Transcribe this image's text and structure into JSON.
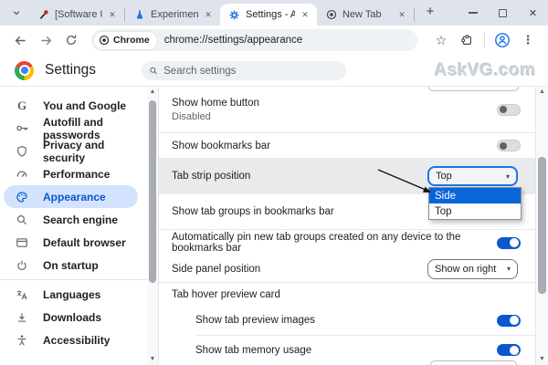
{
  "colors": {
    "accent": "#0b57d0",
    "toggle_on": "#0b57d0",
    "selected_nav_bg": "#d3e3fd",
    "menu_selection_bg": "#0a66d8",
    "tabstrip_bg": "#dfe3ec",
    "row_highlight": "#e9eaeb"
  },
  "icons": {
    "tab-search": "chevron-down",
    "tab-close": "x",
    "new-tab": "plus",
    "minimize": "dash",
    "maximize": "square",
    "close-window": "x",
    "back": "arrow-left",
    "forward": "arrow-right",
    "reload": "circular-arrow",
    "site-badge": "chrome-logo-mono",
    "bookmark": "star-outline",
    "extensions": "puzzle-piece",
    "profile": "person-in-circle",
    "menu": "kebab-dots",
    "settings-search": "magnifier",
    "scroll-up": "triangle-up",
    "scroll-down": "triangle-down",
    "annotation": "black-arrow"
  },
  "tabstrip": {
    "close_glyph": "✕",
    "new_tab_glyph": "+",
    "tabs": [
      {
        "title": "[Software Updat",
        "favicon": "software-update-icon",
        "active": false
      },
      {
        "title": "Experiments",
        "favicon": "flask-icon",
        "active": false
      },
      {
        "title": "Settings - Appea",
        "favicon": "settings-gear-icon",
        "active": true
      },
      {
        "title": "New Tab",
        "favicon": "chrome-mono-icon",
        "active": false
      }
    ]
  },
  "toolbar": {
    "chip_label": "Chrome",
    "url": "chrome://settings/appearance",
    "star_glyph": "☆",
    "kebab_glyph": "⋮"
  },
  "header": {
    "title": "Settings",
    "search_placeholder": "Search settings",
    "watermark": "AskVG.com"
  },
  "sidebar": {
    "items": [
      {
        "label": "You and Google",
        "icon": "google-g-icon",
        "selected": false
      },
      {
        "label": "Autofill and passwords",
        "icon": "key-icon",
        "selected": false
      },
      {
        "label": "Privacy and security",
        "icon": "shield-icon",
        "selected": false
      },
      {
        "label": "Performance",
        "icon": "speedometer-icon",
        "selected": false
      },
      {
        "label": "Appearance",
        "icon": "palette-icon",
        "selected": true
      },
      {
        "label": "Search engine",
        "icon": "search-icon",
        "selected": false
      },
      {
        "label": "Default browser",
        "icon": "browser-window-icon",
        "selected": false
      },
      {
        "label": "On startup",
        "icon": "power-icon",
        "selected": false
      },
      {
        "label": "Languages",
        "icon": "translate-icon",
        "selected": false
      },
      {
        "label": "Downloads",
        "icon": "download-icon",
        "selected": false
      },
      {
        "label": "Accessibility",
        "icon": "accessibility-icon",
        "selected": false
      }
    ]
  },
  "content": {
    "rows": {
      "show_home_button": {
        "label": "Show home button",
        "sublabel": "Disabled",
        "toggle": "off"
      },
      "show_bookmarks_bar": {
        "label": "Show bookmarks bar",
        "toggle": "off"
      },
      "tab_strip_position": {
        "label": "Tab strip position",
        "value": "Top"
      },
      "show_tab_groups": {
        "label": "Show tab groups in bookmarks bar"
      },
      "auto_pin": {
        "label": "Automatically pin new tab groups created on any device to the bookmarks bar",
        "toggle": "on"
      },
      "side_panel_position": {
        "label": "Side panel position",
        "value": "Show on right"
      },
      "tab_hover_preview": {
        "label": "Tab hover preview card"
      },
      "show_tab_preview_images": {
        "label": "Show tab preview images",
        "toggle": "on"
      },
      "show_tab_memory_usage": {
        "label": "Show tab memory usage",
        "toggle": "on"
      }
    },
    "dropdown_menu": {
      "options": [
        {
          "label": "Side",
          "highlighted": true
        },
        {
          "label": "Top",
          "highlighted": false
        }
      ]
    },
    "select_caret_glyph": "▾"
  },
  "scrollbars": {
    "up_glyph": "▲",
    "down_glyph": "▼"
  }
}
